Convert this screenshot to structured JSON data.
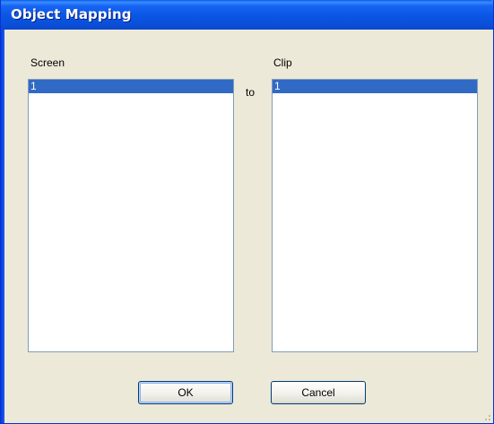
{
  "window": {
    "title": "Object Mapping"
  },
  "screen_list": {
    "label": "Screen",
    "items": [
      "1"
    ],
    "selected_index": 0
  },
  "connector": {
    "label": "to"
  },
  "clip_list": {
    "label": "Clip",
    "items": [
      "1"
    ],
    "selected_index": 0
  },
  "buttons": {
    "ok_label": "OK",
    "cancel_label": "Cancel"
  },
  "colors": {
    "titlebar": "#0a55e3",
    "selection": "#316ac5",
    "dialog_bg": "#ece9d8"
  }
}
